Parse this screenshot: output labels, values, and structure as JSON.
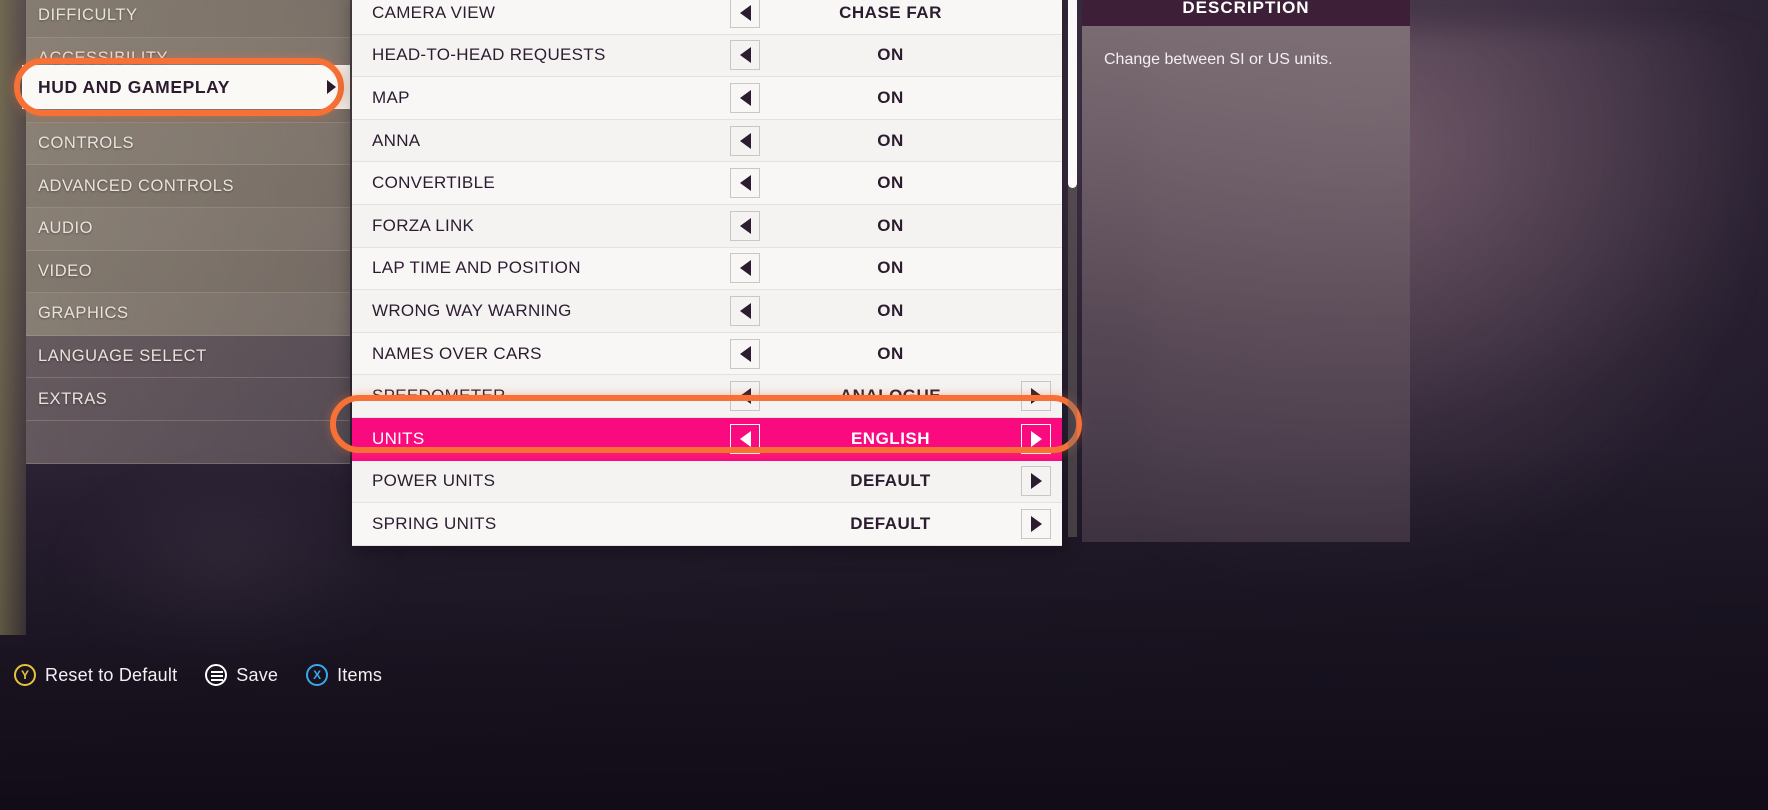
{
  "sidebar": {
    "items": [
      {
        "label": "DIFFICULTY",
        "selected": false
      },
      {
        "label": "ACCESSIBILITY",
        "selected": false
      },
      {
        "label": "HUD AND GAMEPLAY",
        "selected": true
      },
      {
        "label": "CONTROLS",
        "selected": false
      },
      {
        "label": "ADVANCED CONTROLS",
        "selected": false
      },
      {
        "label": "AUDIO",
        "selected": false
      },
      {
        "label": "VIDEO",
        "selected": false
      },
      {
        "label": "GRAPHICS",
        "selected": false
      },
      {
        "label": "LANGUAGE SELECT",
        "selected": false
      },
      {
        "label": "EXTRAS",
        "selected": false
      }
    ],
    "selected_label": "HUD AND GAMEPLAY"
  },
  "settings": {
    "rows": [
      {
        "name": "CAMERA VIEW",
        "value": "CHASE FAR",
        "left_arrow": true,
        "right_arrow": false,
        "selected": false
      },
      {
        "name": "HEAD-TO-HEAD REQUESTS",
        "value": "ON",
        "left_arrow": true,
        "right_arrow": false,
        "selected": false
      },
      {
        "name": "MAP",
        "value": "ON",
        "left_arrow": true,
        "right_arrow": false,
        "selected": false
      },
      {
        "name": "ANNA",
        "value": "ON",
        "left_arrow": true,
        "right_arrow": false,
        "selected": false
      },
      {
        "name": "CONVERTIBLE",
        "value": "ON",
        "left_arrow": true,
        "right_arrow": false,
        "selected": false
      },
      {
        "name": "FORZA LINK",
        "value": "ON",
        "left_arrow": true,
        "right_arrow": false,
        "selected": false
      },
      {
        "name": "LAP TIME AND POSITION",
        "value": "ON",
        "left_arrow": true,
        "right_arrow": false,
        "selected": false
      },
      {
        "name": "WRONG WAY WARNING",
        "value": "ON",
        "left_arrow": true,
        "right_arrow": false,
        "selected": false
      },
      {
        "name": "NAMES OVER CARS",
        "value": "ON",
        "left_arrow": true,
        "right_arrow": false,
        "selected": false
      },
      {
        "name": "SPEEDOMETER",
        "value": "ANALOGUE",
        "left_arrow": true,
        "right_arrow": true,
        "selected": false
      },
      {
        "name": "UNITS",
        "value": "ENGLISH",
        "left_arrow": true,
        "right_arrow": true,
        "selected": true
      },
      {
        "name": "POWER UNITS",
        "value": "DEFAULT",
        "left_arrow": false,
        "right_arrow": true,
        "selected": false
      },
      {
        "name": "SPRING UNITS",
        "value": "DEFAULT",
        "left_arrow": false,
        "right_arrow": true,
        "selected": false
      }
    ]
  },
  "description": {
    "header": "DESCRIPTION",
    "text": "Change between SI or US units."
  },
  "bottom_hints": [
    {
      "button": "Y",
      "label": "Reset to Default",
      "glyph": "y-button-icon"
    },
    {
      "button": "MENU",
      "label": "Save",
      "glyph": "menu-button-icon"
    },
    {
      "button": "X",
      "label": "Items",
      "glyph": "x-button-icon"
    }
  ],
  "colors": {
    "selection_magenta": "#f90b7f",
    "highlight_orange": "#f77136",
    "description_header": "#3d2038",
    "panel_white": "#f7f6f5",
    "y_button": "#e8c33a",
    "x_button": "#3aa8e8"
  }
}
